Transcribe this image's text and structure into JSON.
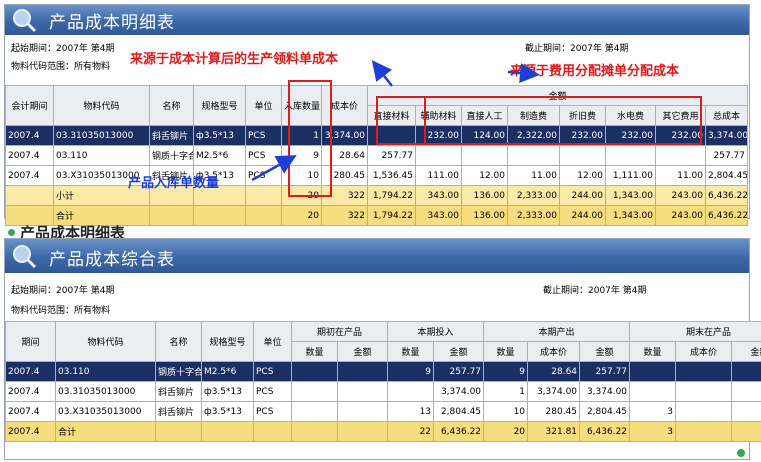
{
  "top": {
    "title": "产品成本明细表",
    "start_period": "起始期间：2007年 第4期",
    "end_period": "截止期间：2007年 第4期",
    "code_range": "物料代码范围：所有物料",
    "headers": {
      "period": "会计期间",
      "code": "物料代码",
      "name": "名称",
      "spec": "规格型号",
      "unit": "单位",
      "qty": "入库数量",
      "unit_cost": "成本价",
      "amount_group": "金额",
      "direct_material": "直接材料",
      "aux_material": "辅助材料",
      "direct_labor": "直接人工",
      "manufacturing": "制造费",
      "depreciation": "折旧费",
      "utilities": "水电费",
      "other": "其它费用",
      "total": "总成本"
    },
    "rows": [
      {
        "period": "2007.4",
        "code": "03.31035013000",
        "name": "斜舌铆片",
        "spec": "ф3.5*13",
        "unit": "PCS",
        "qty": "1",
        "unit_cost": "3,374.00",
        "direct_material": "",
        "aux_material": "232.00",
        "direct_labor": "124.00",
        "manufacturing": "2,322.00",
        "depreciation": "232.00",
        "utilities": "232.00",
        "other": "232.00",
        "total": "3,374.00",
        "style": "sel"
      },
      {
        "period": "2007.4",
        "code": "03.110",
        "name": "钢质十字合",
        "spec": "M2.5*6",
        "unit": "PCS",
        "qty": "9",
        "unit_cost": "28.64",
        "direct_material": "257.77",
        "aux_material": "",
        "direct_labor": "",
        "manufacturing": "",
        "depreciation": "",
        "utilities": "",
        "other": "",
        "total": "257.77",
        "style": "wh"
      },
      {
        "period": "2007.4",
        "code": "03.X31035013000",
        "name": "斜舌铆片",
        "spec": "ф3.5*13",
        "unit": "PCS",
        "qty": "10",
        "unit_cost": "280.45",
        "direct_material": "1,536.45",
        "aux_material": "111.00",
        "direct_labor": "12.00",
        "manufacturing": "11.00",
        "depreciation": "12.00",
        "utilities": "1,111.00",
        "other": "11.00",
        "total": "2,804.45",
        "style": "wh"
      },
      {
        "period": "",
        "code": "小计",
        "name": "",
        "spec": "",
        "unit": "",
        "qty": "20",
        "unit_cost": "322",
        "direct_material": "1,794.22",
        "aux_material": "343.00",
        "direct_labor": "136.00",
        "manufacturing": "2,333.00",
        "depreciation": "244.00",
        "utilities": "1,343.00",
        "other": "243.00",
        "total": "6,436.22",
        "style": "sub"
      },
      {
        "period": "",
        "code": "合计",
        "name": "",
        "spec": "",
        "unit": "",
        "qty": "20",
        "unit_cost": "322",
        "direct_material": "1,794.22",
        "aux_material": "343.00",
        "direct_labor": "136.00",
        "manufacturing": "2,333.00",
        "depreciation": "244.00",
        "utilities": "1,343.00",
        "other": "243.00",
        "total": "6,436.22",
        "style": "tot"
      }
    ],
    "annotations": {
      "production_material": "来源于成本计算后的生产领料单成本",
      "expense_allocation": "来源于费用分配摊单分配成本",
      "inbound_qty": "产品入库单数量"
    }
  },
  "ghost_text": "产品成本明细表",
  "bottom": {
    "title": "产品成本综合表",
    "start_period": "起始期间：2007年 第4期",
    "end_period": "截止期间：2007年 第4期",
    "code_range": "物料代码范围：所有物料",
    "headers": {
      "period": "期间",
      "code": "物料代码",
      "name": "名称",
      "spec": "规格型号",
      "unit": "单位",
      "begin_wip": "期初在产品",
      "current_input": "本期投入",
      "current_output": "本期产出",
      "end_wip": "期末在产品",
      "qty": "数量",
      "amount": "金额",
      "unit_cost": "成本价"
    },
    "rows": [
      {
        "period": "2007.4",
        "code": "03.110",
        "name": "钢质十字合",
        "spec": "M2.5*6",
        "unit": "PCS",
        "b_qty": "",
        "b_amt": "",
        "i_qty": "9",
        "i_amt": "257.77",
        "o_qty": "9",
        "o_cost": "28.64",
        "o_amt": "257.77",
        "e_qty": "",
        "e_cost": "",
        "e_amt": "",
        "style": "sel"
      },
      {
        "period": "2007.4",
        "code": "03.31035013000",
        "name": "斜舌铆片",
        "spec": "ф3.5*13",
        "unit": "PCS",
        "b_qty": "",
        "b_amt": "",
        "i_qty": "",
        "i_amt": "3,374.00",
        "o_qty": "1",
        "o_cost": "3,374.00",
        "o_amt": "3,374.00",
        "e_qty": "",
        "e_cost": "",
        "e_amt": "",
        "style": "wh"
      },
      {
        "period": "2007.4",
        "code": "03.X31035013000",
        "name": "斜舌铆片",
        "spec": "ф3.5*13",
        "unit": "PCS",
        "b_qty": "",
        "b_amt": "",
        "i_qty": "13",
        "i_amt": "2,804.45",
        "o_qty": "10",
        "o_cost": "280.45",
        "o_amt": "2,804.45",
        "e_qty": "3",
        "e_cost": "",
        "e_amt": "",
        "style": "wh"
      },
      {
        "period": "2007.4",
        "code": "合计",
        "name": "",
        "spec": "",
        "unit": "",
        "b_qty": "",
        "b_amt": "",
        "i_qty": "22",
        "i_amt": "6,436.22",
        "o_qty": "20",
        "o_cost": "321.81",
        "o_amt": "6,436.22",
        "e_qty": "3",
        "e_cost": "",
        "e_amt": "",
        "style": "tot"
      }
    ]
  }
}
